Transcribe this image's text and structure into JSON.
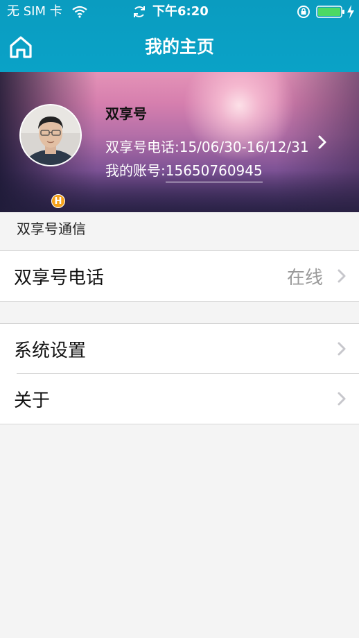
{
  "status_bar": {
    "carrier": "无 SIM 卡",
    "time": "下午6:20",
    "icons": [
      "wifi-icon",
      "sync-icon",
      "orientation-lock-icon",
      "battery-icon",
      "charging-icon"
    ],
    "battery_level": 1.0
  },
  "nav": {
    "title": "我的主页",
    "home_icon": "home-icon"
  },
  "profile": {
    "name": "双享号",
    "phone_line": "双享号电话:15/06/30-16/12/31",
    "account_label": "我的账号:",
    "account_number": "15650760945",
    "badge": "H"
  },
  "sections": {
    "comm_header": "双享号通信",
    "phone_label": "双享号电话",
    "phone_status": "在线",
    "settings_label": "系统设置",
    "about_label": "关于"
  },
  "colors": {
    "nav_bar": "#0aa2c7",
    "badge": "#f4a21b",
    "status_value": "#9a9a9a"
  }
}
